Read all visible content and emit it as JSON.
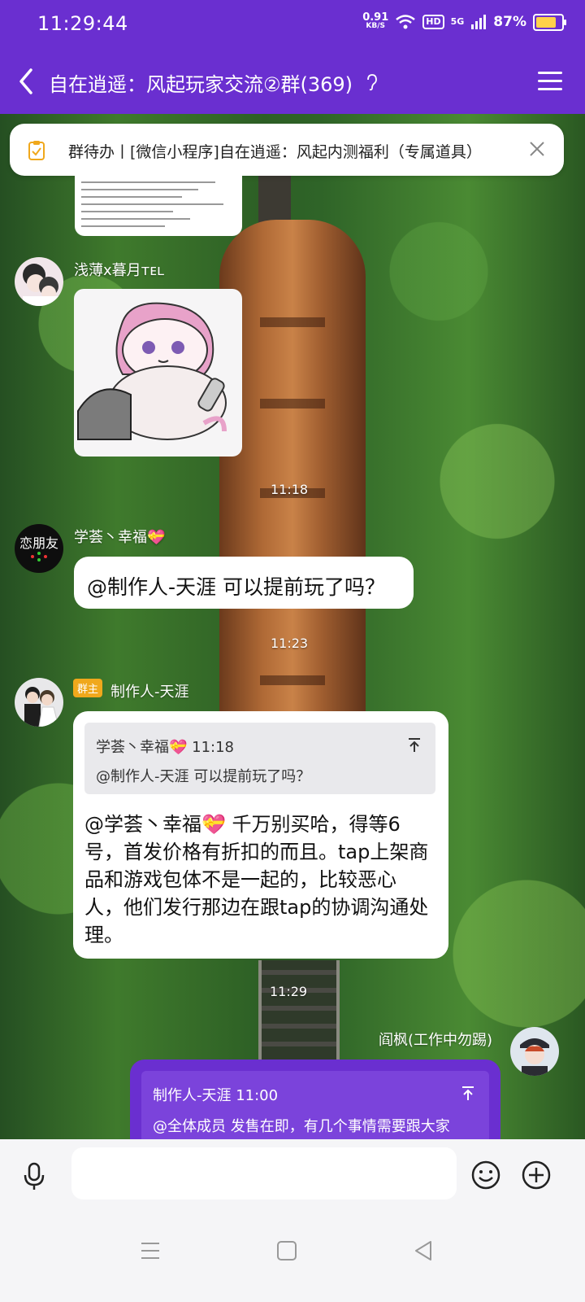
{
  "status_bar": {
    "time": "11:29:44",
    "net_speed_value": "0.91",
    "net_speed_unit": "KB/S",
    "hd_label": "HD",
    "signal_label": "5G",
    "battery_percent": "87%",
    "battery_level": 0.87
  },
  "header": {
    "title": "自在逍遥：风起玩家交流②群(369)",
    "icons": [
      "back-icon",
      "ear-icon",
      "menu-icon"
    ]
  },
  "todo_banner": {
    "text": "群待办丨[微信小程序]自在逍遥：风起内测福利（专属道具）",
    "icons": [
      "todo-icon",
      "close-icon"
    ]
  },
  "messages": [
    {
      "sender": "浅薄ⅹ暮月ᴛᴇʟ",
      "type": "image",
      "image_desc": "sticker"
    },
    {
      "timestamp": "11:18"
    },
    {
      "sender": "学荟丶幸福💝",
      "text": "@制作人-天涯 可以提前玩了吗？",
      "avatar_text": "恋朋友"
    },
    {
      "timestamp": "11:23"
    },
    {
      "sender": "制作人-天涯",
      "badge": "群主",
      "quote_head": "学荟丶幸福💝 11:18",
      "quote_body": "@制作人-天涯 可以提前玩了吗？",
      "text": "@学荟丶幸福💝 千万别买哈，得等6号，首发价格有折扣的而且。tap上架商品和游戏包体不是一起的，比较恶心人，他们发行那边在跟tap的协调沟通处理。"
    },
    {
      "timestamp": "11:29"
    },
    {
      "sender": "阎枫(工作中勿踢)",
      "quote_head": "制作人-天涯 11:00",
      "quote_body": "@全体成员 发售在即，有几个事情需要跟大家"
    }
  ],
  "input": {
    "placeholder": "",
    "icons": [
      "mic-icon",
      "emoji-icon",
      "plus-icon"
    ]
  },
  "nav": {
    "icons": [
      "menu-nav-icon",
      "home-nav-icon",
      "back-nav-icon"
    ]
  },
  "colors": {
    "accent": "#6a2fd0",
    "badge": "#f0a81c"
  }
}
